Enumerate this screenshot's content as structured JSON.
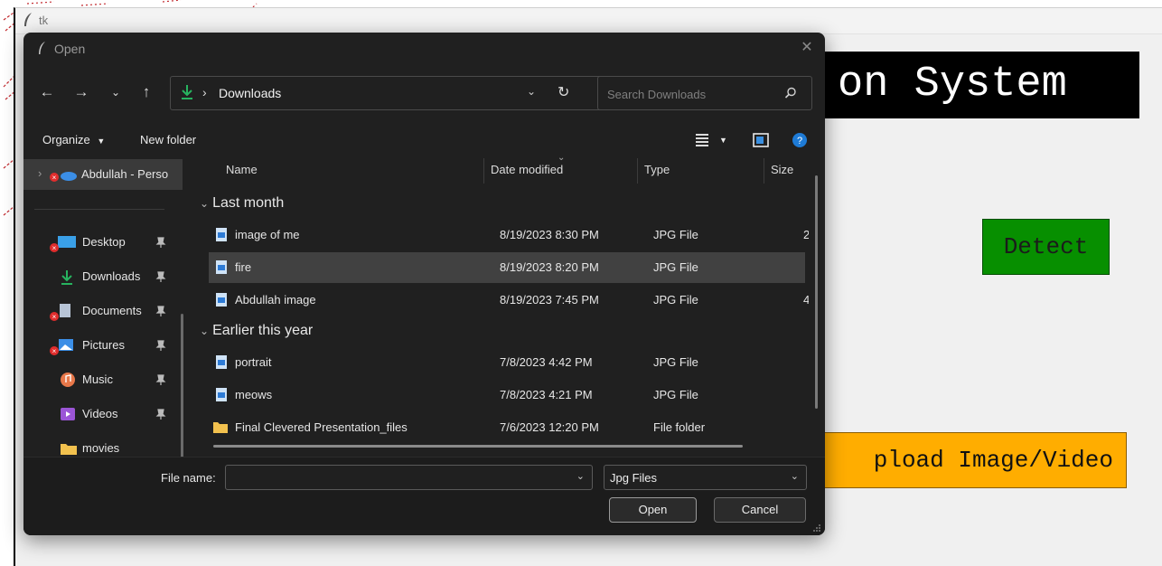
{
  "tk_window": {
    "title": "tk",
    "heading": "on System",
    "detect_label": "Detect",
    "upload_label": "pload Image/Video",
    "colors": {
      "heading_bg": "#000000",
      "detect_bg": "#078f00",
      "upload_bg": "#ffad00"
    }
  },
  "dialog": {
    "title": "Open",
    "address": {
      "location": "Downloads"
    },
    "search": {
      "placeholder": "Search Downloads"
    },
    "toolbar": {
      "organize_label": "Organize",
      "new_folder_label": "New folder"
    },
    "sidebar": {
      "items": [
        {
          "label": "Abdullah - Perso",
          "icon": "onedrive-icon"
        },
        {
          "label": "Desktop",
          "icon": "desktop-icon"
        },
        {
          "label": "Downloads",
          "icon": "download-icon"
        },
        {
          "label": "Documents",
          "icon": "documents-icon"
        },
        {
          "label": "Pictures",
          "icon": "pictures-icon"
        },
        {
          "label": "Music",
          "icon": "music-icon"
        },
        {
          "label": "Videos",
          "icon": "videos-icon"
        },
        {
          "label": "movies",
          "icon": "folder-icon"
        }
      ]
    },
    "columns": {
      "name": "Name",
      "date": "Date modified",
      "type": "Type",
      "size": "Size"
    },
    "groups": [
      {
        "label": "Last month",
        "files": [
          {
            "name": "image of me",
            "date": "8/19/2023 8:30 PM",
            "type": "JPG File",
            "size": "2"
          },
          {
            "name": "fire",
            "date": "8/19/2023 8:20 PM",
            "type": "JPG File",
            "size": ""
          },
          {
            "name": "Abdullah image",
            "date": "8/19/2023 7:45 PM",
            "type": "JPG File",
            "size": "4"
          }
        ]
      },
      {
        "label": "Earlier this year",
        "files": [
          {
            "name": "portrait",
            "date": "7/8/2023 4:42 PM",
            "type": "JPG File",
            "size": ""
          },
          {
            "name": "meows",
            "date": "7/8/2023 4:21 PM",
            "type": "JPG File",
            "size": ""
          },
          {
            "name": "Final Clevered Presentation_files",
            "date": "7/6/2023 12:20 PM",
            "type": "File folder",
            "size": ""
          }
        ]
      }
    ],
    "file_name": {
      "label": "File name:",
      "value": ""
    },
    "file_type": {
      "value": "Jpg Files"
    },
    "open_label": "Open",
    "cancel_label": "Cancel"
  }
}
